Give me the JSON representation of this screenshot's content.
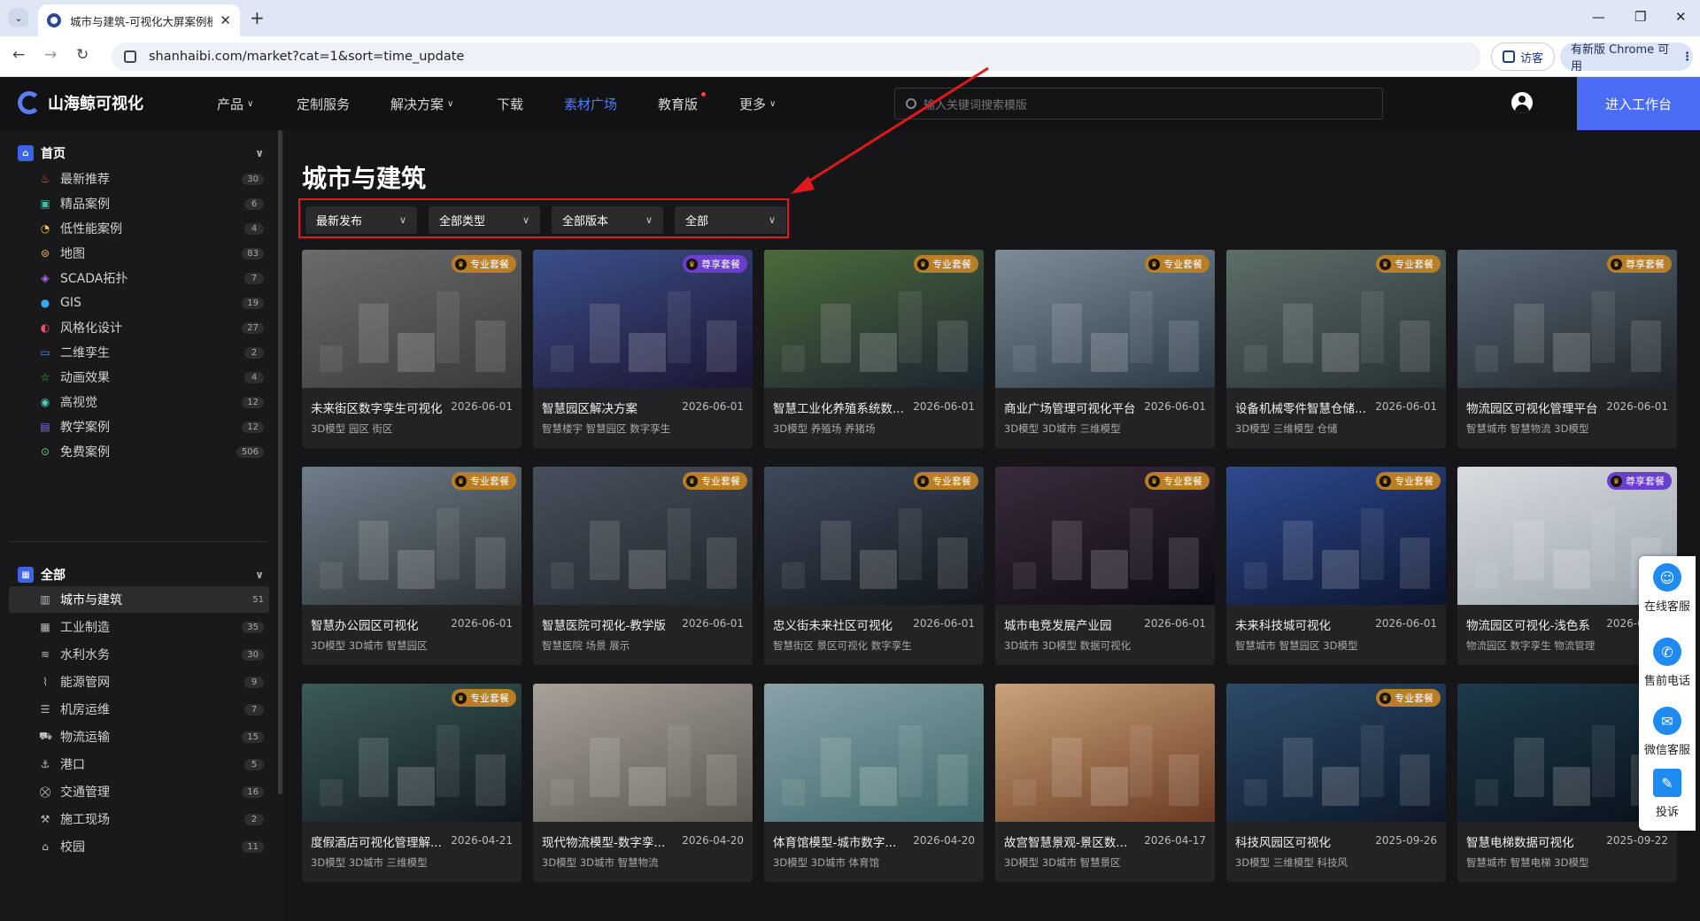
{
  "browser": {
    "tab_title": "城市与建筑-可视化大屏案例模",
    "url": "shanhaibi.com/market?cat=1&sort=time_update",
    "visitor_label": "访客",
    "update_label": "有新版 Chrome 可用"
  },
  "header": {
    "logo_text": "山海鲸可视化",
    "nav": [
      "产品",
      "定制服务",
      "解决方案",
      "下载",
      "素材广场",
      "教育版",
      "更多"
    ],
    "search_placeholder": "输入关键词搜索模版",
    "enter_button": "进入工作台"
  },
  "sidebar": {
    "home_label": "首页",
    "home_items": [
      {
        "label": "最新推荐",
        "count": "30",
        "icon": "fire-icon"
      },
      {
        "label": "精品案例",
        "count": "6",
        "icon": "screen-icon"
      },
      {
        "label": "低性能案例",
        "count": "4",
        "icon": "gauge-icon"
      },
      {
        "label": "地图",
        "count": "83",
        "icon": "map-icon"
      },
      {
        "label": "SCADA拓扑",
        "count": "7",
        "icon": "cube-icon"
      },
      {
        "label": "GIS",
        "count": "19",
        "icon": "globe-icon"
      },
      {
        "label": "风格化设计",
        "count": "27",
        "icon": "palette-icon"
      },
      {
        "label": "二维孪生",
        "count": "2",
        "icon": "twin-icon"
      },
      {
        "label": "动画效果",
        "count": "4",
        "icon": "star-icon"
      },
      {
        "label": "高视觉",
        "count": "12",
        "icon": "eye-icon"
      },
      {
        "label": "教学案例",
        "count": "12",
        "icon": "book-icon"
      },
      {
        "label": "免费案例",
        "count": "506",
        "icon": "free-icon"
      }
    ],
    "all_label": "全部",
    "all_items": [
      {
        "label": "城市与建筑",
        "count": "51",
        "icon": "building-icon"
      },
      {
        "label": "工业制造",
        "count": "35",
        "icon": "factory-icon"
      },
      {
        "label": "水利水务",
        "count": "30",
        "icon": "water-icon"
      },
      {
        "label": "能源管网",
        "count": "9",
        "icon": "pipe-icon"
      },
      {
        "label": "机房运维",
        "count": "7",
        "icon": "server-icon"
      },
      {
        "label": "物流运输",
        "count": "15",
        "icon": "truck-icon"
      },
      {
        "label": "港口",
        "count": "5",
        "icon": "port-icon"
      },
      {
        "label": "交通管理",
        "count": "16",
        "icon": "traffic-icon"
      },
      {
        "label": "施工现场",
        "count": "2",
        "icon": "construction-icon"
      },
      {
        "label": "校园",
        "count": "11",
        "icon": "campus-icon"
      }
    ]
  },
  "page_title": "城市与建筑",
  "filters": [
    "最新发布",
    "全部类型",
    "全部版本",
    "全部"
  ],
  "cards": [
    {
      "title": "未来街区数字孪生可视化",
      "date": "2026-06-01",
      "tags": "3D模型  园区  街区",
      "badge": "专业套餐",
      "badge_type": "pro",
      "thumb": [
        "#6b6b6b",
        "#3a3a3a"
      ]
    },
    {
      "title": "智慧园区解决方案",
      "date": "2026-06-01",
      "tags": "智慧楼宇  智慧园区  数字孪生",
      "badge": "尊享套餐",
      "badge_type": "prem",
      "thumb": [
        "#3c4f8a",
        "#1a1530"
      ]
    },
    {
      "title": "智慧工业化养殖系统数...",
      "date": "2026-06-01",
      "tags": "3D模型  养殖场  养猪场",
      "badge": "专业套餐",
      "badge_type": "pro",
      "thumb": [
        "#4d6a3b",
        "#1a2530"
      ]
    },
    {
      "title": "商业广场管理可视化平台",
      "date": "2026-06-01",
      "tags": "3D模型  3D城市  三维模型",
      "badge": "专业套餐",
      "badge_type": "pro",
      "thumb": [
        "#7c8c99",
        "#2a3a44"
      ]
    },
    {
      "title": "设备机械零件智慧仓储...",
      "date": "2026-06-01",
      "tags": "3D模型  三维模型  仓储",
      "badge": "专业套餐",
      "badge_type": "pro",
      "thumb": [
        "#5c6e6a",
        "#263033"
      ]
    },
    {
      "title": "物流园区可视化管理平台",
      "date": "2026-06-01",
      "tags": "智慧城市  智慧物流  3D模型",
      "badge": "尊享套餐",
      "badge_type": "pro",
      "thumb": [
        "#5a6b78",
        "#1e2429"
      ]
    },
    {
      "title": "智慧办公园区可视化",
      "date": "2026-06-01",
      "tags": "3D模型  3D城市  智慧园区",
      "badge": "专业套餐",
      "badge_type": "pro",
      "thumb": [
        "#6f7f8a",
        "#2b3034"
      ]
    },
    {
      "title": "智慧医院可视化-教学版",
      "date": "2026-06-01",
      "tags": "智慧医院  场景  展示",
      "badge": "专业套餐",
      "badge_type": "pro",
      "thumb": [
        "#48505c",
        "#1f252c"
      ]
    },
    {
      "title": "忠义街未来社区可视化",
      "date": "2026-06-01",
      "tags": "智慧街区  景区可视化  数字孪生",
      "badge": "专业套餐",
      "badge_type": "pro",
      "thumb": [
        "#3e4a5a",
        "#12161c"
      ]
    },
    {
      "title": "城市电竞发展产业园",
      "date": "2026-06-01",
      "tags": "3D城市  3D模型  数据可视化",
      "badge": "专业套餐",
      "badge_type": "pro",
      "thumb": [
        "#3a2b3d",
        "#0d0a12"
      ]
    },
    {
      "title": "未来科技城可视化",
      "date": "2026-06-01",
      "tags": "智慧城市  智慧园区  3D模型",
      "badge": "专业套餐",
      "badge_type": "pro",
      "thumb": [
        "#2f4a8f",
        "#0c1530"
      ]
    },
    {
      "title": "物流园区可视化-浅色系",
      "date": "2026-06-01",
      "tags": "物流园区  数字孪生  物流管理",
      "badge": "尊享套餐",
      "badge_type": "prem",
      "thumb": [
        "#d8dce0",
        "#9ba4ad"
      ]
    },
    {
      "title": "度假酒店可视化管理解...",
      "date": "2026-04-21",
      "tags": "3D模型  3D城市  三维模型",
      "badge": "专业套餐",
      "badge_type": "pro",
      "thumb": [
        "#3d5a5a",
        "#10181c"
      ]
    },
    {
      "title": "现代物流模型-数字孪...",
      "date": "2026-04-20",
      "tags": "3D模型  3D城市  智慧物流",
      "badge": "",
      "badge_type": "",
      "thumb": [
        "#a7a29a",
        "#5b5650"
      ]
    },
    {
      "title": "体育馆模型-城市数字...",
      "date": "2026-04-20",
      "tags": "3D模型  3D城市  体育馆",
      "badge": "",
      "badge_type": "",
      "thumb": [
        "#8aa2a8",
        "#3e6a6a"
      ]
    },
    {
      "title": "故宫智慧景观-景区数...",
      "date": "2026-04-17",
      "tags": "3D模型  3D城市  智慧景区",
      "badge": "",
      "badge_type": "",
      "thumb": [
        "#c9a37a",
        "#6b3a20"
      ]
    },
    {
      "title": "科技风园区可视化",
      "date": "2025-09-26",
      "tags": "3D模型  三维模型  科技风",
      "badge": "专业套餐",
      "badge_type": "pro",
      "thumb": [
        "#2d4a6a",
        "#0c1828"
      ]
    },
    {
      "title": "智慧电梯数据可视化",
      "date": "2025-09-22",
      "tags": "智慧城市  智慧电梯  3D模型",
      "badge": "",
      "badge_type": "",
      "thumb": [
        "#1e3a4a",
        "#08121a"
      ]
    }
  ],
  "float_service": [
    "在线客服",
    "售前电话",
    "微信客服",
    "投诉"
  ]
}
